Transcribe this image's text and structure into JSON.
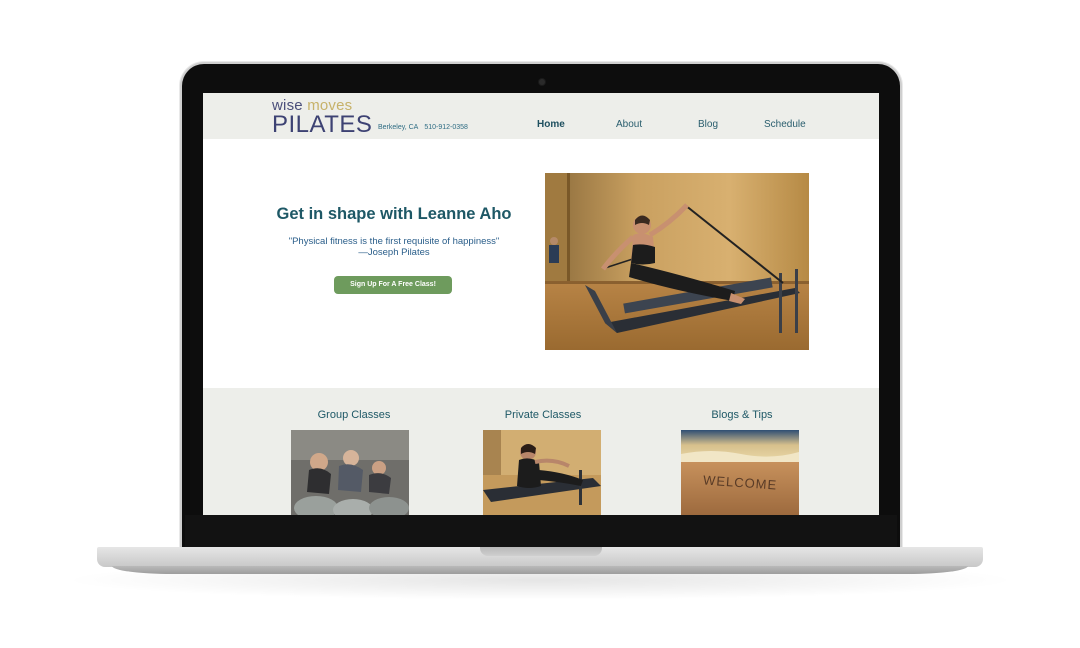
{
  "site": {
    "logo": {
      "line1_a": "wise",
      "line1_b": "moves",
      "line2": "PILATES"
    },
    "contact": {
      "city": "Berkeley, CA",
      "phone": "510-912-0358"
    },
    "nav": [
      {
        "label": "Home"
      },
      {
        "label": "About"
      },
      {
        "label": "Blog"
      },
      {
        "label": "Schedule"
      }
    ],
    "hero": {
      "heading": "Get in shape with Leanne Aho",
      "quote": "\"Physical fitness is the first requisite of happiness\"",
      "quote_author": "—Joseph Pilates",
      "cta": "Sign Up For A Free Class!"
    },
    "sections": [
      {
        "title": "Group Classes"
      },
      {
        "title": "Private Classes"
      },
      {
        "title": "Blogs & Tips",
        "image_text": "WELCOME"
      }
    ]
  },
  "colors": {
    "header_bg": "#edeeea",
    "accent_teal": "#1e5866",
    "cta_green": "#6e9b5d",
    "logo_gold": "#c7b26a",
    "logo_navy": "#3d4273"
  }
}
